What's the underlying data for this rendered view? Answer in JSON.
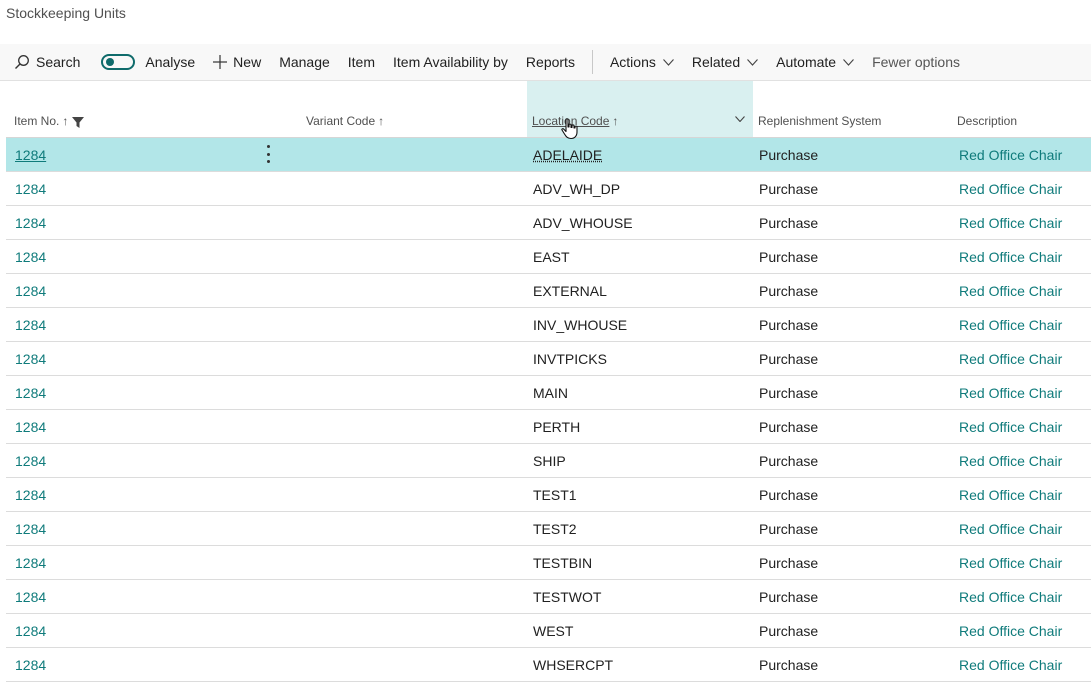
{
  "page": {
    "title": "Stockkeeping Units"
  },
  "toolbar": {
    "search": "Search",
    "analyse": "Analyse",
    "new": "New",
    "manage": "Manage",
    "item": "Item",
    "item_availability": "Item Availability by",
    "reports": "Reports",
    "actions": "Actions",
    "related": "Related",
    "automate": "Automate",
    "fewer_options": "Fewer options"
  },
  "columns": {
    "item_no": "Item No.",
    "variant_code": "Variant Code",
    "location_code": "Location Code",
    "replenishment": "Replenishment System",
    "description": "Description"
  },
  "rows": [
    {
      "item_no": "1284",
      "variant": "",
      "location": "ADELAIDE",
      "replenishment": "Purchase",
      "description": "Red Office Chair"
    },
    {
      "item_no": "1284",
      "variant": "",
      "location": "ADV_WH_DP",
      "replenishment": "Purchase",
      "description": "Red Office Chair"
    },
    {
      "item_no": "1284",
      "variant": "",
      "location": "ADV_WHOUSE",
      "replenishment": "Purchase",
      "description": "Red Office Chair"
    },
    {
      "item_no": "1284",
      "variant": "",
      "location": "EAST",
      "replenishment": "Purchase",
      "description": "Red Office Chair"
    },
    {
      "item_no": "1284",
      "variant": "",
      "location": "EXTERNAL",
      "replenishment": "Purchase",
      "description": "Red Office Chair"
    },
    {
      "item_no": "1284",
      "variant": "",
      "location": "INV_WHOUSE",
      "replenishment": "Purchase",
      "description": "Red Office Chair"
    },
    {
      "item_no": "1284",
      "variant": "",
      "location": "INVTPICKS",
      "replenishment": "Purchase",
      "description": "Red Office Chair"
    },
    {
      "item_no": "1284",
      "variant": "",
      "location": "MAIN",
      "replenishment": "Purchase",
      "description": "Red Office Chair"
    },
    {
      "item_no": "1284",
      "variant": "",
      "location": "PERTH",
      "replenishment": "Purchase",
      "description": "Red Office Chair"
    },
    {
      "item_no": "1284",
      "variant": "",
      "location": "SHIP",
      "replenishment": "Purchase",
      "description": "Red Office Chair"
    },
    {
      "item_no": "1284",
      "variant": "",
      "location": "TEST1",
      "replenishment": "Purchase",
      "description": "Red Office Chair"
    },
    {
      "item_no": "1284",
      "variant": "",
      "location": "TEST2",
      "replenishment": "Purchase",
      "description": "Red Office Chair"
    },
    {
      "item_no": "1284",
      "variant": "",
      "location": "TESTBIN",
      "replenishment": "Purchase",
      "description": "Red Office Chair"
    },
    {
      "item_no": "1284",
      "variant": "",
      "location": "TESTWOT",
      "replenishment": "Purchase",
      "description": "Red Office Chair"
    },
    {
      "item_no": "1284",
      "variant": "",
      "location": "WEST",
      "replenishment": "Purchase",
      "description": "Red Office Chair"
    },
    {
      "item_no": "1284",
      "variant": "",
      "location": "WHSERCPT",
      "replenishment": "Purchase",
      "description": "Red Office Chair"
    }
  ],
  "colors": {
    "accent": "#0f7b7b",
    "selected_row": "#b2e6e8",
    "active_header": "#d9f0f0"
  }
}
